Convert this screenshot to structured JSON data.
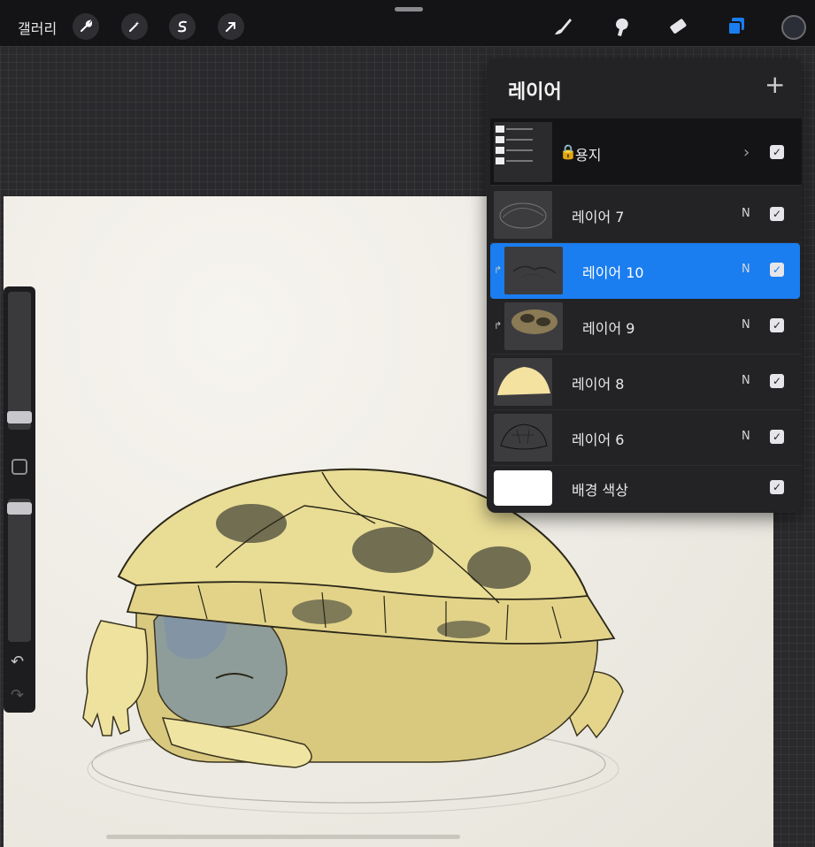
{
  "toolbar": {
    "gallery_label": "갤러리",
    "left_tools": [
      "wrench-icon",
      "magic-wand-icon",
      "selection-s-icon",
      "arrow-transform-icon"
    ],
    "right_tools": [
      "brush-icon",
      "smudge-icon",
      "eraser-icon",
      "layers-icon"
    ],
    "active_color": "#2b2e36"
  },
  "layers_panel": {
    "title": "레이어",
    "add_label": "+",
    "layers": [
      {
        "name": "용지",
        "locked": true,
        "group": true,
        "visible": true
      },
      {
        "name": "레이어 7",
        "blend": "N",
        "visible": true
      },
      {
        "name": "레이어 10",
        "blend": "N",
        "visible": true,
        "active": true,
        "clipped": true
      },
      {
        "name": "레이어 9",
        "blend": "N",
        "visible": true,
        "clipped": true
      },
      {
        "name": "레이어 8",
        "blend": "N",
        "visible": true
      },
      {
        "name": "레이어 6",
        "blend": "N",
        "visible": true
      },
      {
        "name": "배경 색상",
        "visible": true
      }
    ]
  },
  "sidebar": {
    "brush_size_level": 0.05,
    "opacity_level": 0.97,
    "undo_icon": "undo-icon",
    "redo_icon": "redo-icon"
  },
  "colors": {
    "accent": "#1a7df0",
    "paper": "#f1efe8",
    "shell": "#e9dc95"
  }
}
